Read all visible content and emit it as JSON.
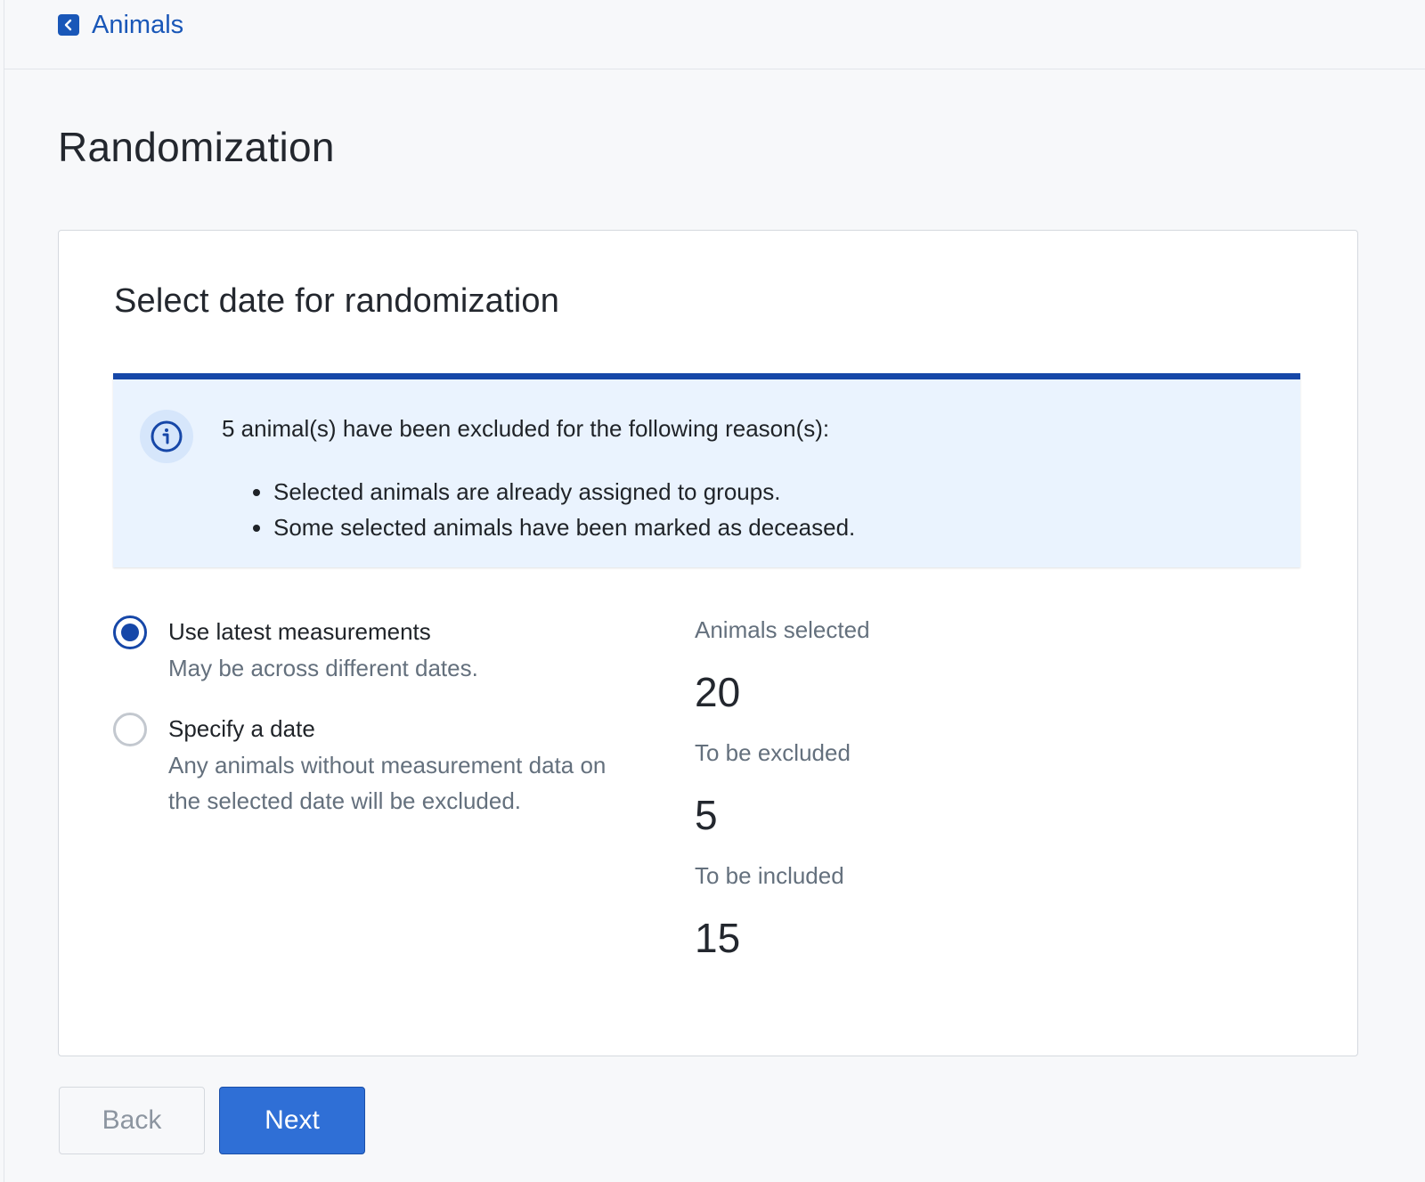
{
  "header": {
    "back_label": "Animals"
  },
  "page": {
    "title": "Randomization"
  },
  "card": {
    "title": "Select date for randomization",
    "notice": {
      "heading": "5 animal(s) have been excluded for the following reason(s):",
      "reasons": [
        "Selected animals are already assigned to groups.",
        "Some selected animals have been marked as deceased."
      ]
    },
    "options": [
      {
        "label": "Use latest measurements",
        "help": "May be across different dates.",
        "selected": true
      },
      {
        "label": "Specify a date",
        "help": "Any animals without measurement data on the selected date will be excluded.",
        "selected": false
      }
    ],
    "stats": [
      {
        "label": "Animals selected",
        "value": "20"
      },
      {
        "label": "To be excluded",
        "value": "5"
      },
      {
        "label": "To be included",
        "value": "15"
      }
    ]
  },
  "footer": {
    "back_label": "Back",
    "next_label": "Next"
  },
  "colors": {
    "primary": "#1647a8",
    "button_primary": "#2f6fd6",
    "notice_bg": "#eaf3fe",
    "muted_text": "#64707d"
  }
}
